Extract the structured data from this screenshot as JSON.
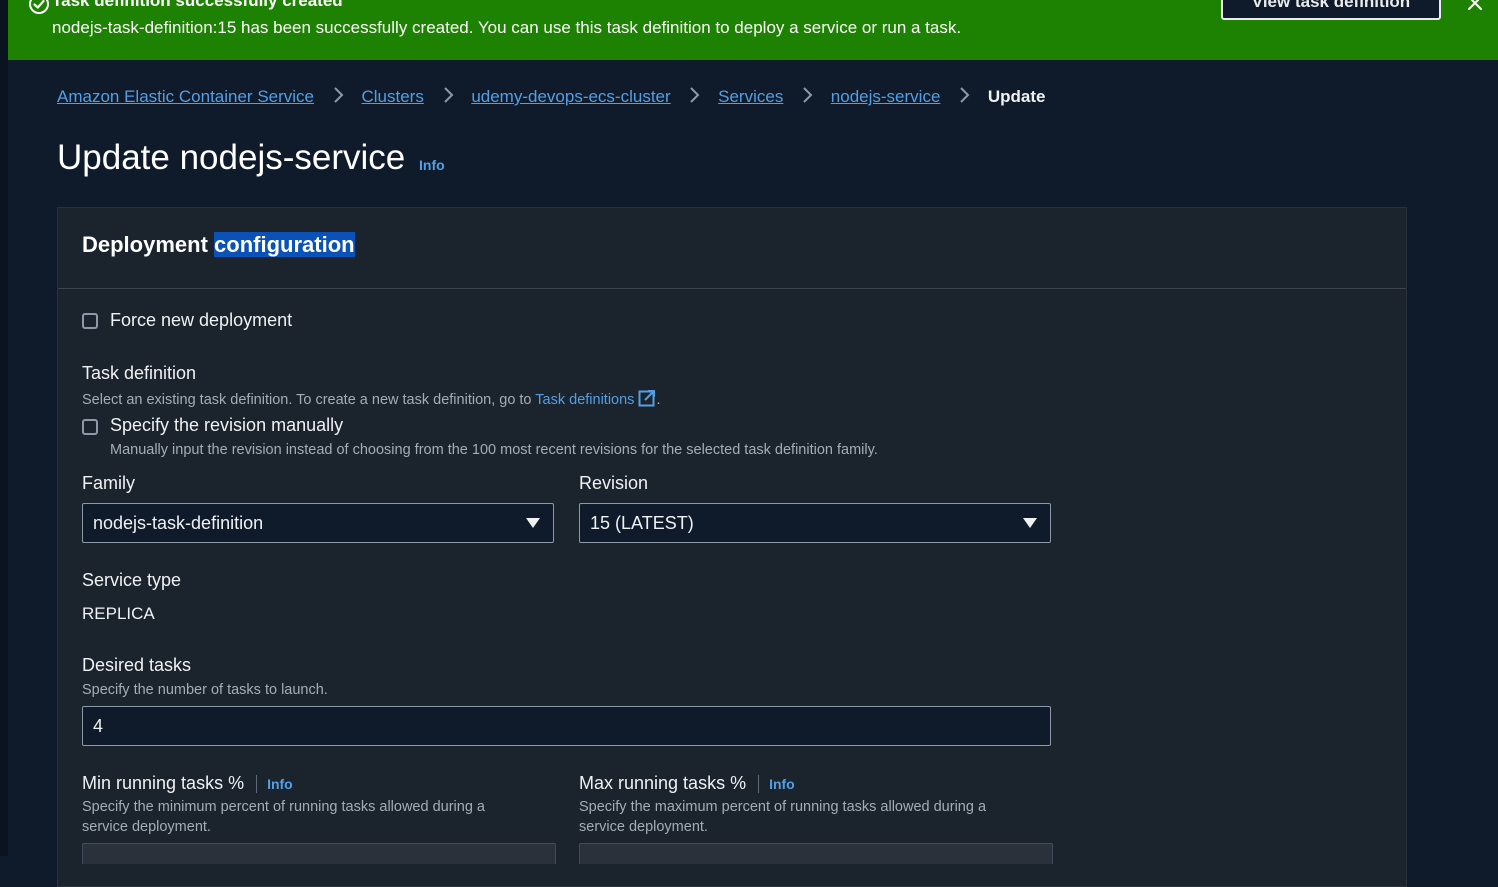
{
  "flash": {
    "title": "Task definition successfully created",
    "message": "nodejs-task-definition:15 has been successfully created. You can use this task definition to deploy a service or run a task.",
    "view_button": "View task definition",
    "color": "#1d8102"
  },
  "breadcrumb": {
    "items": [
      "Amazon Elastic Container Service",
      "Clusters",
      "udemy-devops-ecs-cluster",
      "Services",
      "nodejs-service"
    ],
    "current": "Update"
  },
  "page": {
    "title": "Update nodejs-service",
    "info": "Info"
  },
  "panel": {
    "heading_part1": "Deployment",
    "heading_part2": "configuration"
  },
  "form": {
    "force_new_deployment": "Force new deployment",
    "task_definition_label": "Task definition",
    "task_definition_desc": "Select an existing task definition. To create a new task definition, go to",
    "task_definitions_link": "Task definitions",
    "specify_revision_label": "Specify the revision manually",
    "specify_revision_desc": "Manually input the revision instead of choosing from the 100 most recent revisions for the selected task definition family.",
    "family_label": "Family",
    "family_value": "nodejs-task-definition",
    "revision_label": "Revision",
    "revision_value": "15 (LATEST)",
    "service_type_label": "Service type",
    "service_type_value": "REPLICA",
    "desired_tasks_label": "Desired tasks",
    "desired_tasks_desc": "Specify the number of tasks to launch.",
    "desired_tasks_value": "4",
    "min_running_label": "Min running tasks %",
    "min_running_info": "Info",
    "min_running_desc_1": "Specify the minimum percent of running tasks allowed during a",
    "min_running_desc_2": "service deployment.",
    "max_running_label": "Max running tasks %",
    "max_running_info": "Info",
    "max_running_desc_1": "Specify the maximum percent of running tasks allowed during a",
    "max_running_desc_2": "service deployment."
  },
  "colors": {
    "link": "#539fe5",
    "background": "#0f1b2a",
    "panel": "#1b232d",
    "highlight": "#0b52b8"
  }
}
